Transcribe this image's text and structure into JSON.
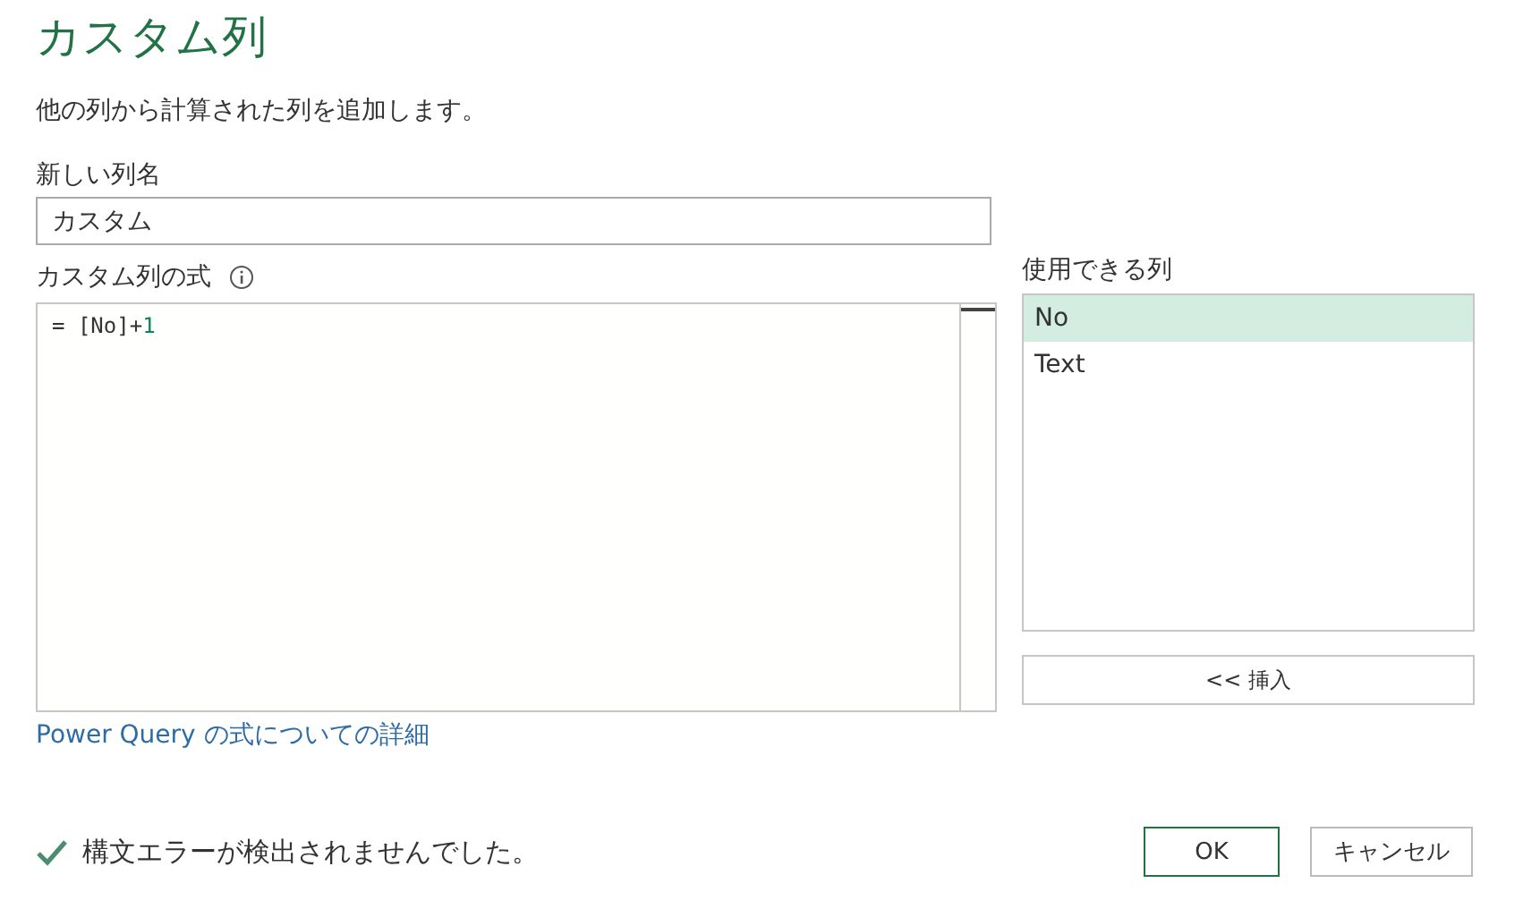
{
  "title": "カスタム列",
  "description": "他の列から計算された列を追加します。",
  "new_column": {
    "label": "新しい列名",
    "value": "カスタム"
  },
  "formula": {
    "label": "カスタム列の式",
    "tokens": [
      {
        "text": "= [No]+",
        "kind": "plain"
      },
      {
        "text": "1",
        "kind": "number"
      }
    ]
  },
  "available_columns": {
    "label": "使用できる列",
    "items": [
      {
        "name": "No",
        "selected": true
      },
      {
        "name": "Text",
        "selected": false
      }
    ],
    "insert_button": "<< 挿入"
  },
  "help_link": "Power Query の式についての詳細",
  "status": {
    "ok": true,
    "message": "構文エラーが検出されませんでした。"
  },
  "buttons": [
    {
      "label": "OK",
      "kind": "primary"
    },
    {
      "label": "キャンセル",
      "kind": "secondary"
    }
  ]
}
